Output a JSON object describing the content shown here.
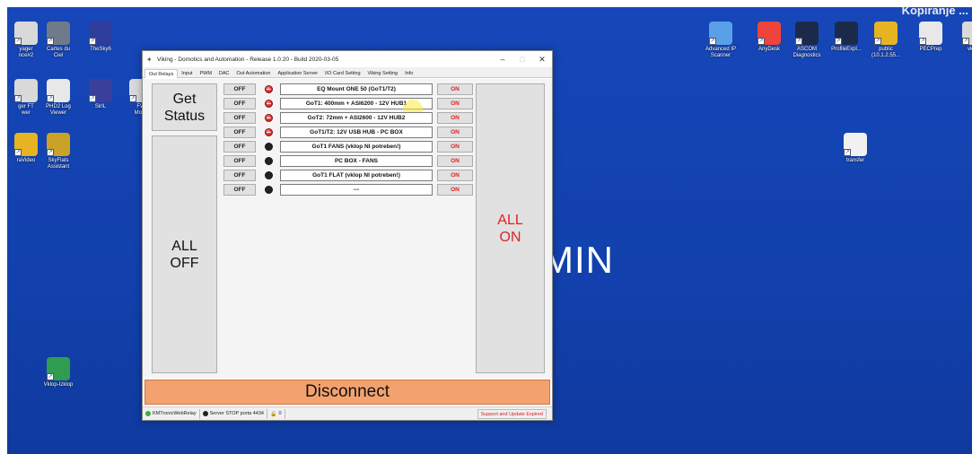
{
  "desktop": {
    "background_color": "#1241ad",
    "background_text": "MIN",
    "banner_text": "Kopiranje ...",
    "left_icons": [
      {
        "label": "yager\nnce#2",
        "icon": "app-icon",
        "color": "#d9d9d9"
      },
      {
        "label": "Cartes du\nCiel",
        "icon": "map-icon",
        "color": "#6f7a8a"
      },
      {
        "label": "TheSky6",
        "icon": "sky-icon",
        "color": "#2e3d9a"
      },
      {
        "label": "ger FT\nwer",
        "icon": "app-icon",
        "color": "#d9d9d9"
      },
      {
        "label": "PHD2 Log\nViewer",
        "icon": "magnifier-icon",
        "color": "#e8e8e8"
      },
      {
        "label": "SirIL",
        "icon": "siril-icon",
        "color": "#3a3f9a"
      },
      {
        "label": "FW\nMonit",
        "icon": "app-icon",
        "color": "#d9d9d9"
      },
      {
        "label": "raVideo",
        "icon": "folder-icon",
        "color": "#e6b422"
      },
      {
        "label": "SkyFlats\nAssistant",
        "icon": "telescope-icon",
        "color": "#c9a227"
      },
      {
        "label": "Vklop-Izklop",
        "icon": "chrome-icon",
        "color": "#2f9c4f"
      }
    ],
    "right_icons": [
      {
        "label": "Advanced IP\nScanner",
        "icon": "network-icon",
        "color": "#5aa0e8"
      },
      {
        "label": "AnyDesk",
        "icon": "anydesk-icon",
        "color": "#ef443b"
      },
      {
        "label": "ASCOM\nDiagnostics",
        "icon": "ascom-icon",
        "color": "#1b2a4a"
      },
      {
        "label": "ProfileExpl...",
        "icon": "ascom-icon",
        "color": "#1b2a4a"
      },
      {
        "label": "public\n(10.1.2.55...",
        "icon": "share-icon",
        "color": "#e6b422"
      },
      {
        "label": "PECPrep",
        "icon": "pecprep-icon",
        "color": "#e8e8e8"
      },
      {
        "label": "vklop",
        "icon": "app-icon",
        "color": "#d9d9d9"
      },
      {
        "label": "transfer",
        "icon": "doc-icon",
        "color": "#f1f1f1"
      }
    ]
  },
  "window": {
    "title": "Viking - Domotics and Automation - Release 1.0.20 - Build 2020-03-05",
    "minimize": "–",
    "maximize": "□",
    "close": "✕",
    "tabs": [
      "Out Relays",
      "Input",
      "PWM",
      "DAC",
      "Out Automation",
      "Application Server",
      "I/O Card Setting",
      "Viking Setting",
      "Info"
    ],
    "get_status": "Get\nStatus",
    "all_off": "ALL\nOFF",
    "all_on": "ALL\nON",
    "disconnect": "Disconnect",
    "relays": [
      {
        "off": "OFF",
        "led": "on",
        "name": "EQ Mount ONE 50 (GoT1/T2)",
        "on": "ON"
      },
      {
        "off": "OFF",
        "led": "on",
        "name": "GoT1: 400mm + ASI6200 - 12V HUB1",
        "on": "ON"
      },
      {
        "off": "OFF",
        "led": "on",
        "name": "GoT2: 72mm + ASI2600 - 12V HUB2",
        "on": "ON"
      },
      {
        "off": "OFF",
        "led": "on",
        "name": "GoT1/T2: 12V USB HUB - PC BOX",
        "on": "ON"
      },
      {
        "off": "OFF",
        "led": "off",
        "name": "GoT1 FANS (vklop NI potreben!)",
        "on": "ON"
      },
      {
        "off": "OFF",
        "led": "off",
        "name": "PC BOX - FANS",
        "on": "ON"
      },
      {
        "off": "OFF",
        "led": "off",
        "name": "GoT1 FLAT  (vklop NI potreben!)",
        "on": "ON"
      },
      {
        "off": "OFF",
        "led": "off",
        "name": "---",
        "on": "ON"
      }
    ],
    "status": {
      "web_relay": "KMTronicWebRelay",
      "server": "Server STOP porta 4434",
      "count": "0",
      "support": "Support and Update Expired"
    },
    "colors": {
      "on_text": "#e02222",
      "led_on": "#e33b3b",
      "disconnect_bg": "#f3a26f"
    }
  }
}
